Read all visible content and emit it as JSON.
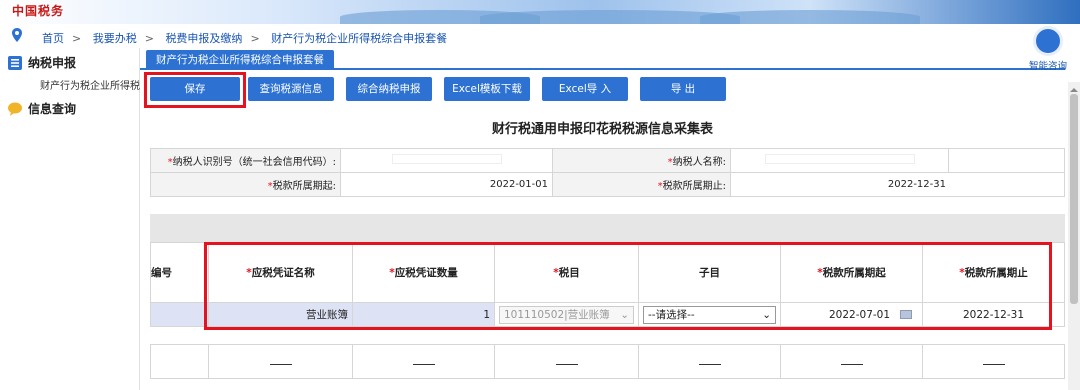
{
  "header": {
    "logo_text": "中国税务"
  },
  "breadcrumb": [
    "首页",
    "我要办税",
    "税费申报及缴纳",
    "财产行为税企业所得税综合申报套餐"
  ],
  "sidebar": {
    "items": [
      {
        "label": "纳税申报"
      },
      {
        "label": "财产行为税企业所得税"
      },
      {
        "label": "信息查询"
      }
    ]
  },
  "tab": {
    "label": "财产行为税企业所得税综合申报套餐"
  },
  "toolbar": {
    "save": "保存",
    "query": "查询税源信息",
    "combined": "综合纳税申报",
    "excel_template": "Excel模板下载",
    "excel_import": "Excel导 入",
    "export": "导 出"
  },
  "form": {
    "title": "财行税通用申报印花税税源信息采集表",
    "taxpayer_id_label": "纳税人识别号（统一社会信用代码）:",
    "taxpayer_name_label": "纳税人名称:",
    "period_start_label": "税款所属期起:",
    "period_start_value": "2022-01-01",
    "period_end_label": "税款所属期止:",
    "period_end_value": "2022-12-31"
  },
  "grid": {
    "headers": [
      "编号",
      "应税凭证名称",
      "应税凭证数量",
      "税目",
      "子目",
      "税款所属期起",
      "税款所属期止"
    ],
    "row": {
      "voucher_name": "营业账簿",
      "voucher_count": "1",
      "tax_item": "101110502|营业账簿",
      "sub_item": "--请选择--",
      "period_start": "2022-07-01",
      "period_end": "2022-12-31"
    },
    "dash": "——"
  },
  "widget": {
    "label": "智能咨询"
  },
  "colors": {
    "primary": "#2d72d2",
    "highlight": "#e3141f",
    "row_bg": "#dde3f5"
  }
}
